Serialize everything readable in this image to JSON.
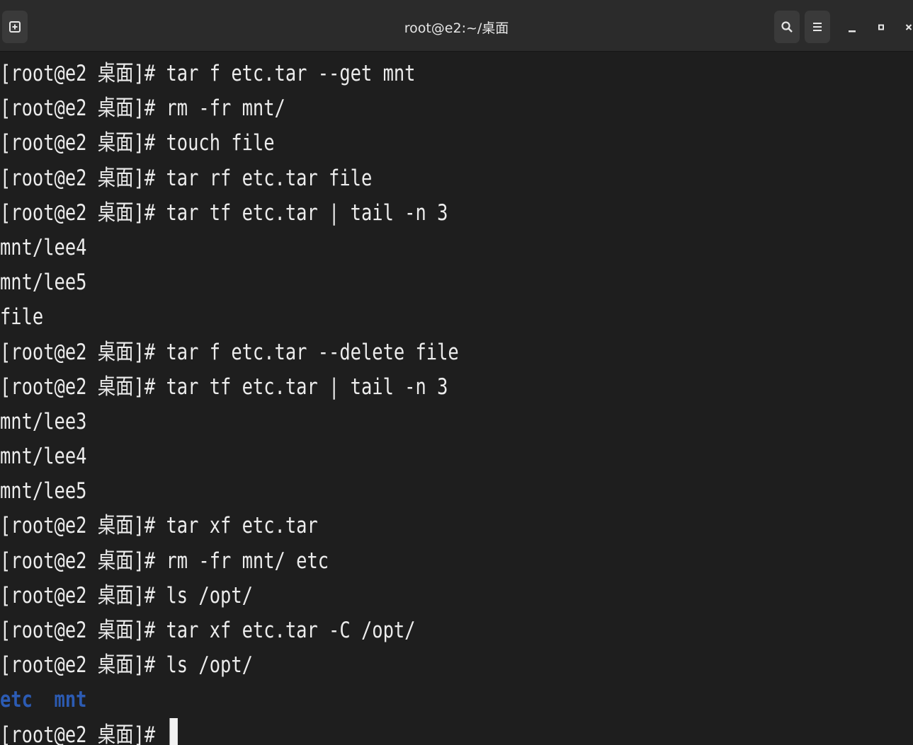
{
  "window": {
    "title": "root@e2:~/桌面"
  },
  "icons": {
    "new_tab": "new-tab-icon",
    "search": "search-icon",
    "menu": "hamburger-menu-icon",
    "minimize": "minimize-icon",
    "maximize": "maximize-icon",
    "close": "close-icon"
  },
  "colors": {
    "background": "#1e1e1e",
    "titlebar": "#2b2b2b",
    "text": "#ececec",
    "directory": "#2c5bb3"
  },
  "terminal": {
    "prompt": "[root@e2 桌面]# ",
    "lines": [
      "[root@e2 桌面]# tar f etc.tar --get mnt",
      "[root@e2 桌面]# rm -fr mnt/",
      "[root@e2 桌面]# touch file",
      "[root@e2 桌面]# tar rf etc.tar file",
      "[root@e2 桌面]# tar tf etc.tar | tail -n 3",
      "mnt/lee4",
      "mnt/lee5",
      "file",
      "[root@e2 桌面]# tar f etc.tar --delete file",
      "[root@e2 桌面]# tar tf etc.tar | tail -n 3",
      "mnt/lee3",
      "mnt/lee4",
      "mnt/lee5",
      "[root@e2 桌面]# tar xf etc.tar",
      "[root@e2 桌面]# rm -fr mnt/ etc",
      "[root@e2 桌面]# ls /opt/",
      "[root@e2 桌面]# tar xf etc.tar -C /opt/",
      "[root@e2 桌面]# ls /opt/"
    ],
    "ls_output": [
      "etc",
      "mnt"
    ]
  }
}
